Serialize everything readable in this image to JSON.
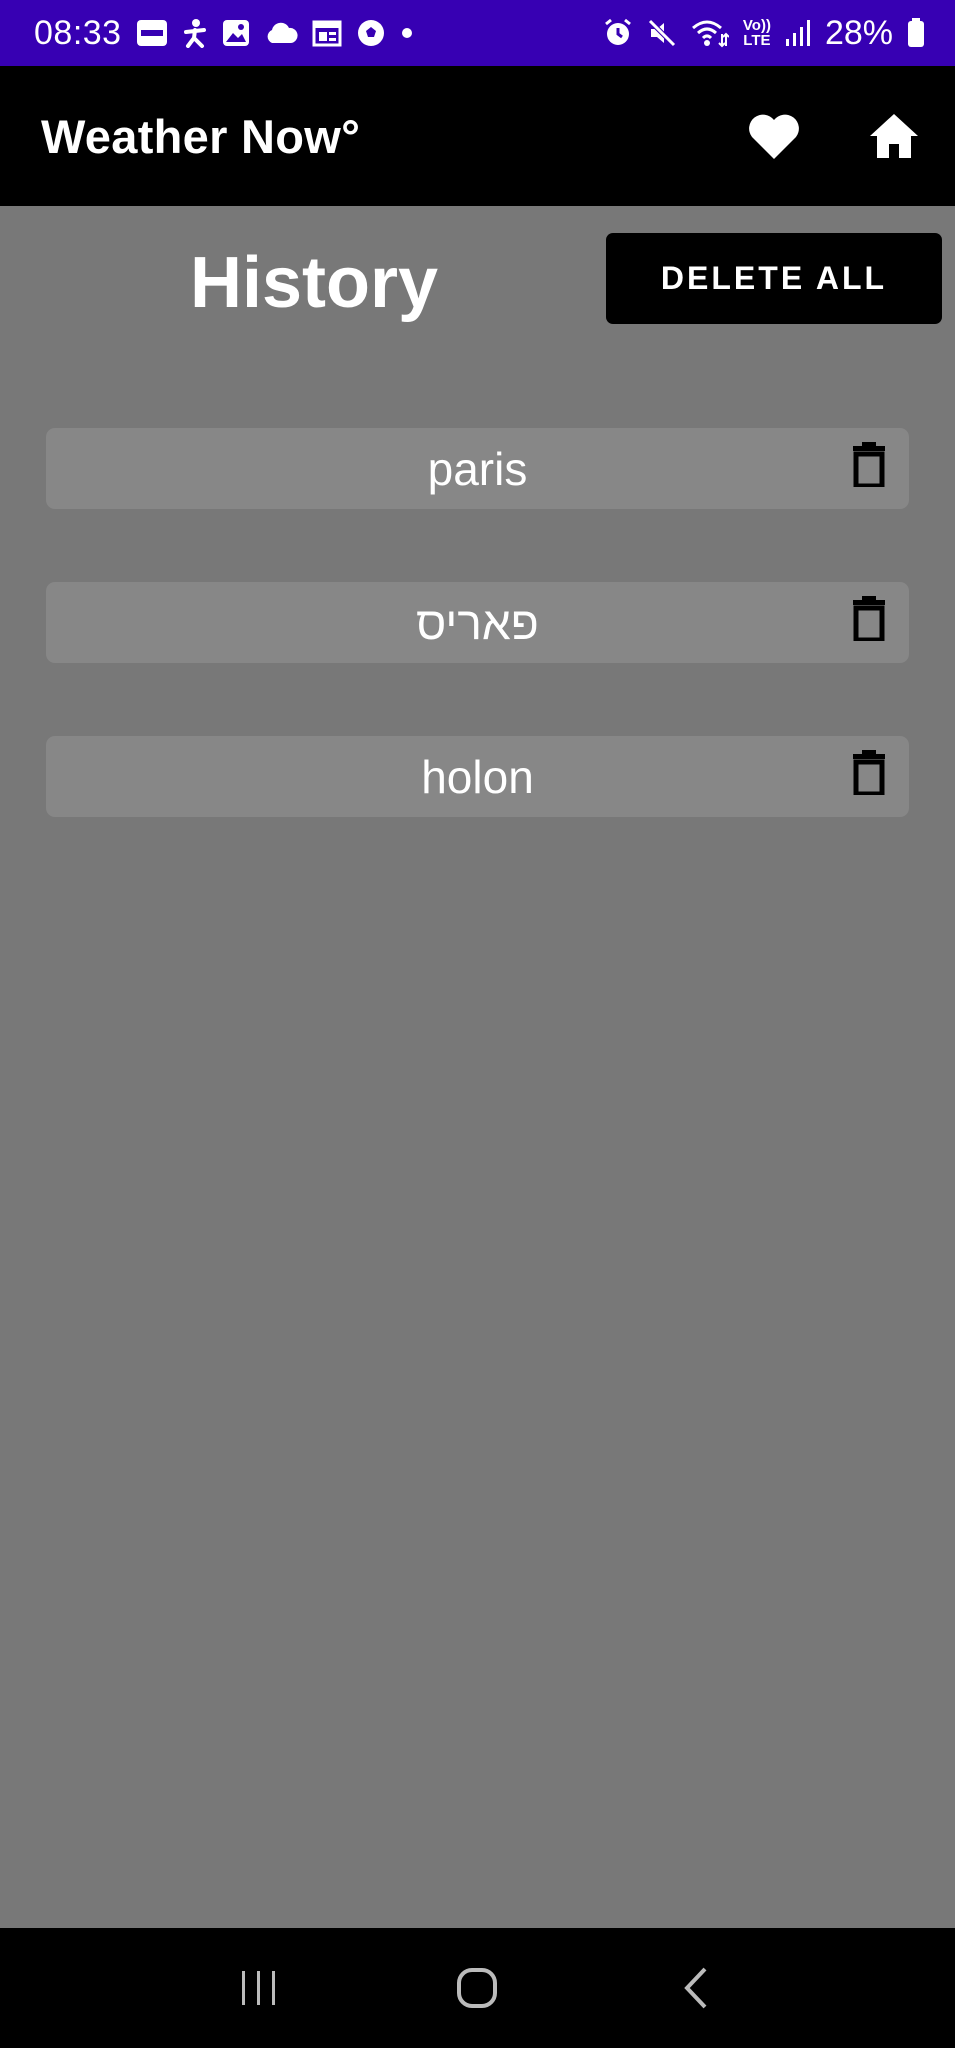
{
  "status_bar": {
    "time": "08:33",
    "battery": "28%",
    "network_label": "LTE",
    "volte_label": "Vo))",
    "icons_left": [
      "news-app-icon",
      "accessibility-icon",
      "gallery-icon",
      "cloud-icon",
      "calendar-icon",
      "soccer-icon",
      "dot-icon"
    ],
    "icons_right": [
      "alarm-icon",
      "mute-icon",
      "wifi-icon",
      "volte-icon",
      "signal-icon",
      "battery-icon"
    ],
    "background": "#3700b3"
  },
  "app_bar": {
    "title": "Weather Now°",
    "actions": [
      "heart-icon",
      "home-icon"
    ],
    "background": "#000000"
  },
  "main": {
    "title": "History",
    "delete_all_label": "DELETE ALL",
    "background": "#787878",
    "items": [
      {
        "label": "paris"
      },
      {
        "label": "פאריס"
      },
      {
        "label": "holon"
      }
    ]
  },
  "nav_bar": {
    "buttons": [
      "recent-apps-icon",
      "home-circle-icon",
      "back-icon"
    ]
  }
}
